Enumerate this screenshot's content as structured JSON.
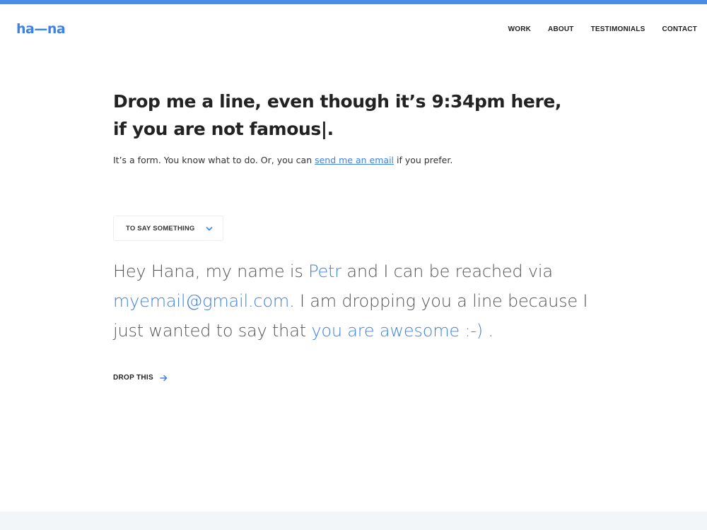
{
  "brand": {
    "logo_text": "ha—na",
    "accent_color": "#3d82e6"
  },
  "nav": {
    "items": [
      {
        "label": "WORK"
      },
      {
        "label": "ABOUT"
      },
      {
        "label": "TESTIMONIALS"
      },
      {
        "label": "CONTACT"
      }
    ]
  },
  "hero": {
    "headline_line1": "Drop me a line, even though it’s 9:34pm here,",
    "headline_line2": "if you are not famous|."
  },
  "intro": {
    "text_before": "It’s a form. You know what to do. Or, you can ",
    "link_text": "send me an email",
    "text_after": " if you prefer."
  },
  "form": {
    "reason_select": {
      "selected": "TO SAY SOMETHING",
      "icon": "chevron-down-icon"
    },
    "message": {
      "part1": "Hey Hana, my name is ",
      "name_value": "Petr",
      "part2": " and I can be reached via ",
      "email_value": "myemail@gmail.com",
      "part3": ". I am dropping you a line because I just wanted to say that ",
      "reason_value": "you are awesome :-)",
      "part4": " ."
    },
    "submit": {
      "label": "DROP THIS",
      "icon": "arrow-right-icon"
    }
  }
}
